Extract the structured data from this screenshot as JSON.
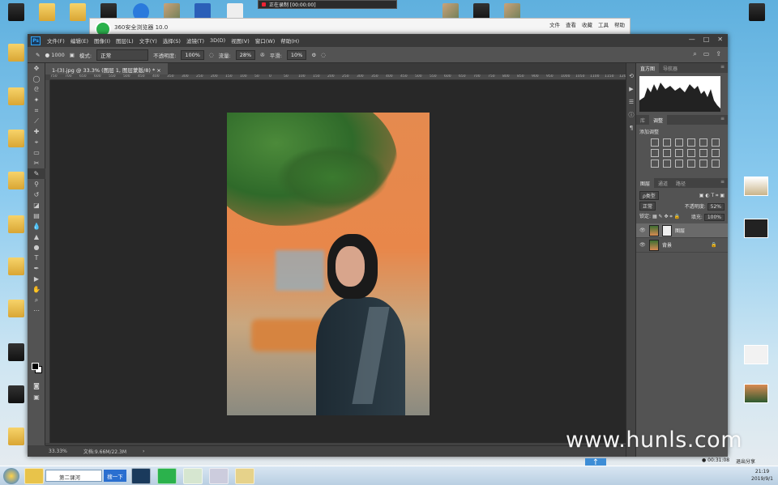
{
  "desktop": {
    "left_icons": [
      "",
      "",
      "",
      "",
      "",
      "",
      "",
      "",
      "",
      "",
      ""
    ],
    "recorder": {
      "status": "正在录制 [00:00:00]"
    }
  },
  "browser": {
    "title": "360安全浏览器 10.0",
    "menu": [
      "文件",
      "查看",
      "收藏",
      "工具",
      "帮助"
    ]
  },
  "photoshop": {
    "logo": "Ps",
    "menu": [
      "文件(F)",
      "编辑(E)",
      "图像(I)",
      "图层(L)",
      "文字(Y)",
      "选择(S)",
      "滤镜(T)",
      "3D(D)",
      "视图(V)",
      "窗口(W)",
      "帮助(H)"
    ],
    "window_controls": [
      "—",
      "□",
      "✕"
    ],
    "options": {
      "brush_size": "1000",
      "mode_label": "模式:",
      "mode_value": "正常",
      "opacity_label": "不透明度:",
      "opacity_value": "100%",
      "flow_label": "流量:",
      "flow_value": "28%",
      "smooth_label": "平滑:",
      "smooth_value": "10%"
    },
    "doc_tab": "1-(3).jpg @ 33.3% (图层 1, 图层蒙版/8) *  ×",
    "ruler_ticks": [
      "750",
      "700",
      "650",
      "600",
      "550",
      "500",
      "450",
      "400",
      "350",
      "300",
      "250",
      "200",
      "150",
      "100",
      "50",
      "0",
      "50",
      "100",
      "150",
      "200",
      "250",
      "300",
      "350",
      "400",
      "450",
      "500",
      "550",
      "600",
      "650",
      "700",
      "750",
      "800",
      "850",
      "900",
      "950",
      "1000",
      "1050",
      "1100",
      "1150",
      "1200",
      "1250",
      "1300",
      "1350",
      "1400",
      "1450",
      "1500",
      "1550",
      "1600",
      "1650",
      "1700",
      "1750",
      "1800",
      "1850",
      "1900",
      "1950",
      "2000",
      "2050",
      "2100",
      "2150",
      "2200",
      "2250",
      "2300",
      "2350",
      "2400",
      "2450",
      "2500",
      "2550",
      "2600",
      "2650",
      "2700"
    ],
    "status": {
      "zoom": "33.33%",
      "doc": "文档:9.66M/22.3M"
    },
    "panels": {
      "top_tabs": [
        "直方图",
        "导航器"
      ],
      "mid_tabs": [
        "库",
        "调整"
      ],
      "adjust_title": "添加调整",
      "layer_tabs": [
        "图层",
        "通道",
        "路径"
      ],
      "kind": "ρ类型",
      "blend": "正常",
      "opacity_label": "不透明度:",
      "opacity_value": "52%",
      "lock_label": "锁定:",
      "fill_label": "填充:",
      "fill_value": "100%",
      "layers": [
        {
          "name": "图层"
        },
        {
          "name": "背景"
        }
      ]
    }
  },
  "taskbar": {
    "search_placeholder": "第二课河",
    "search_button": "搜一下",
    "time": "21:19",
    "date": "2019/9/1",
    "rec_timer": "00:31:08",
    "share": "退出分享"
  },
  "watermark": "www.hunls.com"
}
